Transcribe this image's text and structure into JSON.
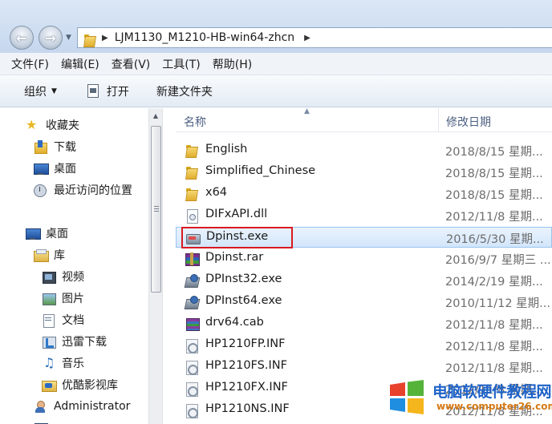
{
  "address_bar": {
    "path": "LJM1130_M1210-HB-win64-zhcn",
    "back_icon": "arrow-left-icon",
    "forward_icon": "arrow-right-icon"
  },
  "menu": [
    {
      "label": "文件(F)"
    },
    {
      "label": "编辑(E)"
    },
    {
      "label": "查看(V)"
    },
    {
      "label": "工具(T)"
    },
    {
      "label": "帮助(H)"
    }
  ],
  "toolbar": {
    "organize": "组织",
    "open": "打开",
    "new_folder": "新建文件夹"
  },
  "nav": {
    "favorites": "收藏夹",
    "downloads": "下载",
    "desktop": "桌面",
    "recent": "最近访问的位置",
    "desktop2": "桌面",
    "libraries": "库",
    "videos": "视频",
    "pictures": "图片",
    "documents": "文档",
    "thunder": "迅雷下载",
    "music": "音乐",
    "youku": "优酷影视库",
    "administrator": "Administrator"
  },
  "columns": {
    "name": "名称",
    "date": "修改日期"
  },
  "files": [
    {
      "name": "English",
      "date": "2018/8/15 星期...",
      "icon": "folder-icon"
    },
    {
      "name": "Simplified_Chinese",
      "date": "2018/8/15 星期...",
      "icon": "folder-icon"
    },
    {
      "name": "x64",
      "date": "2018/8/15 星期...",
      "icon": "folder-icon"
    },
    {
      "name": "DIFxAPI.dll",
      "date": "2012/11/8 星期...",
      "icon": "dll-icon"
    },
    {
      "name": "Dpinst.exe",
      "date": "2016/5/30 星期...",
      "icon": "exe-icon",
      "selected": true
    },
    {
      "name": "Dpinst.rar",
      "date": "2016/9/7 星期三 ...",
      "icon": "rar-icon"
    },
    {
      "name": "DPInst32.exe",
      "date": "2014/2/19 星期...",
      "icon": "installer-icon"
    },
    {
      "name": "DPInst64.exe",
      "date": "2010/11/12 星期...",
      "icon": "installer-icon"
    },
    {
      "name": "drv64.cab",
      "date": "2012/11/8 星期...",
      "icon": "cab-icon"
    },
    {
      "name": "HP1210FP.INF",
      "date": "2012/11/8 星期...",
      "icon": "inf-icon"
    },
    {
      "name": "HP1210FS.INF",
      "date": "2012/11/8 星期...",
      "icon": "inf-icon"
    },
    {
      "name": "HP1210FX.INF",
      "date": "2012/11/8 星期...",
      "icon": "inf-icon"
    },
    {
      "name": "HP1210NS.INF",
      "date": "2012/11/8 星期...",
      "icon": "inf-icon"
    }
  ],
  "watermark": {
    "title": "电脑软硬件教程网",
    "url": "www.computer26.com",
    "colors": {
      "red": "#e8412c",
      "green": "#55b33a",
      "blue": "#1f8ee0",
      "yellow": "#f5b51c"
    }
  },
  "colors": {
    "selection_fill": "#d3e6fb",
    "selection_border": "#99c3ef",
    "highlight_box": "#d71a21",
    "header_text": "#4d6082"
  }
}
